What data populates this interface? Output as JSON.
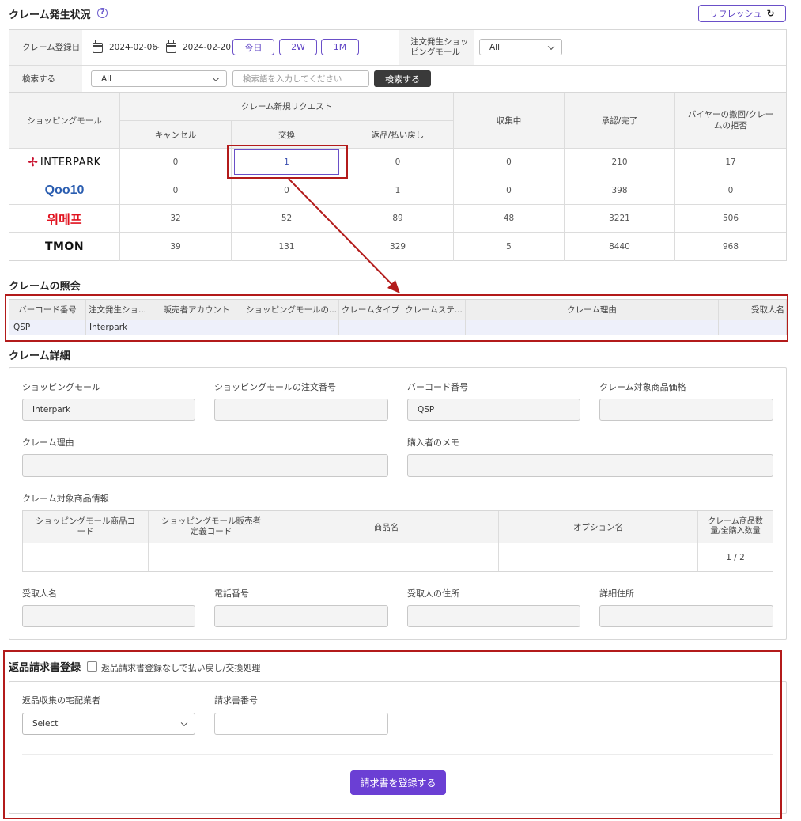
{
  "top": {
    "title": "クレーム発生状況",
    "help": "?",
    "refresh_label": "リフレッシュ",
    "refresh_icon": "↻"
  },
  "filter": {
    "date_label": "クレーム登録日",
    "date_from": "2024-02-06",
    "date_sep": "~",
    "date_to": "2024-02-20",
    "quick": [
      "今日",
      "2W",
      "1M"
    ],
    "mall_label": "注文発生ショッピングモール",
    "mall_value": "All",
    "search_label": "検索する",
    "search_select": "All",
    "search_placeholder": "検索語を入力してください",
    "search_button": "検索する"
  },
  "stats": {
    "col_mall": "ショッピングモール",
    "group_new": "クレーム新規リクエスト",
    "sub_cancel": "キャンセル",
    "sub_exchange": "交換",
    "sub_return": "返品/払い戻し",
    "col_collecting": "収集中",
    "col_approved": "承認/完了",
    "col_withdraw": "バイヤーの撤回/クレームの拒否",
    "rows": [
      {
        "mall": "INTERPARK",
        "cancel": "0",
        "exchange": "1",
        "return": "0",
        "collecting": "0",
        "approved": "210",
        "withdraw": "17"
      },
      {
        "mall": "Qoo10",
        "cancel": "0",
        "exchange": "0",
        "return": "1",
        "collecting": "0",
        "approved": "398",
        "withdraw": "0"
      },
      {
        "mall": "위메프",
        "cancel": "32",
        "exchange": "52",
        "return": "89",
        "collecting": "48",
        "approved": "3221",
        "withdraw": "506"
      },
      {
        "mall": "TMON",
        "cancel": "39",
        "exchange": "131",
        "return": "329",
        "collecting": "5",
        "approved": "8440",
        "withdraw": "968"
      }
    ]
  },
  "inquiry": {
    "title": "クレームの照会",
    "headers": [
      "バーコード番号",
      "注文発生ショ...",
      "販売者アカウント",
      "ショッピングモールの...",
      "クレームタイプ",
      "クレームステ...",
      "クレーム理由",
      "受取人名"
    ],
    "row": [
      "QSP",
      "Interpark",
      "",
      "",
      "",
      "",
      "",
      ""
    ]
  },
  "detail": {
    "title": "クレーム詳細",
    "mall_label": "ショッピングモール",
    "mall_value": "Interpark",
    "order_label": "ショッピングモールの注文番号",
    "barcode_label": "バーコード番号",
    "barcode_value": "QSP",
    "price_label": "クレーム対象商品価格",
    "reason_label": "クレーム理由",
    "memo_label": "購入者のメモ",
    "product_label": "クレーム対象商品情報",
    "product_headers": [
      "ショッピングモール商品コード",
      "ショッピングモール販売者定義コード",
      "商品名",
      "オプション名",
      "クレーム商品数量/全購入数量"
    ],
    "product_qty": "1 / 2",
    "recipient_label": "受取人名",
    "phone_label": "電話番号",
    "address_label": "受取人の住所",
    "address_detail_label": "詳細住所"
  },
  "invoice": {
    "title": "返品請求書登録",
    "checkbox_label": "返品請求書登録なしで払い戻し/交換処理",
    "courier_label": "返品収集の宅配業者",
    "courier_value": "Select",
    "number_label": "請求書番号",
    "submit": "請求書を登録する"
  },
  "logo_colors": {
    "interpark": "#c8102e",
    "qoo10_q": "#e4002b",
    "qoo10_text": "#2a5db0",
    "wemakeprice": "#e1121f",
    "tmon": "#111111",
    "tmon_o": "#f26522"
  }
}
